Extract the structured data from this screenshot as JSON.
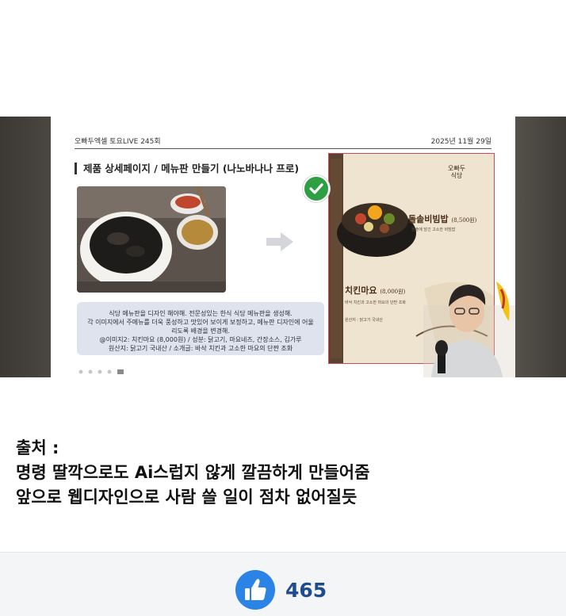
{
  "video": {
    "slide_header_left": "오빠두엑셀 토요LIVE 245회",
    "slide_header_right": "2025년 11월 29일",
    "slide_title": "제품 상세페이지 / 메뉴판 만들기 (나노바나나 프로)",
    "prompt_lines": [
      "식당 메뉴판을 디자인 해야해. 전문성있는 한식 식당 메뉴판을 생성해.",
      "각 이미지에서 주메뉴를 더욱 풍성하고 맛있어 보이게 보정하고, 메뉴판 디자인에 어울",
      "리도록 배경을 변경해.",
      "@이미지2: 치킨마요 (8,000원) / 성분: 닭고기, 마요네즈, 간장소스, 김가루",
      "원산지: 닭고기 국내산 / 소개글: 바삭 치킨과 고소한 마요의 단짠 조화"
    ],
    "menu": {
      "sign": [
        "오빠두",
        "식당"
      ],
      "item1_name": "돌솥비빔밥",
      "item1_price": "(8,500원)",
      "item1_desc": "돌솥에 담긴 고소한 비빔밥",
      "item2_name": "치킨마요",
      "item2_price": "(8,000원)",
      "item2_desc": "바삭 치킨과 고소한 마요의 단짠 조화",
      "item2_desc2": "원산지 : 닭고기 국내산"
    }
  },
  "caption": {
    "line1": "출처 :",
    "line2": "명령 딸깍으로도 Ai스럽지 않게 깔끔하게 만들어줌",
    "line3": "앞으로 웹디자인으로 사람 쓸 일이 점차 없어질듯"
  },
  "like": {
    "count": "465",
    "icon": "thumbs-up-icon",
    "color": "#2b83e6"
  }
}
